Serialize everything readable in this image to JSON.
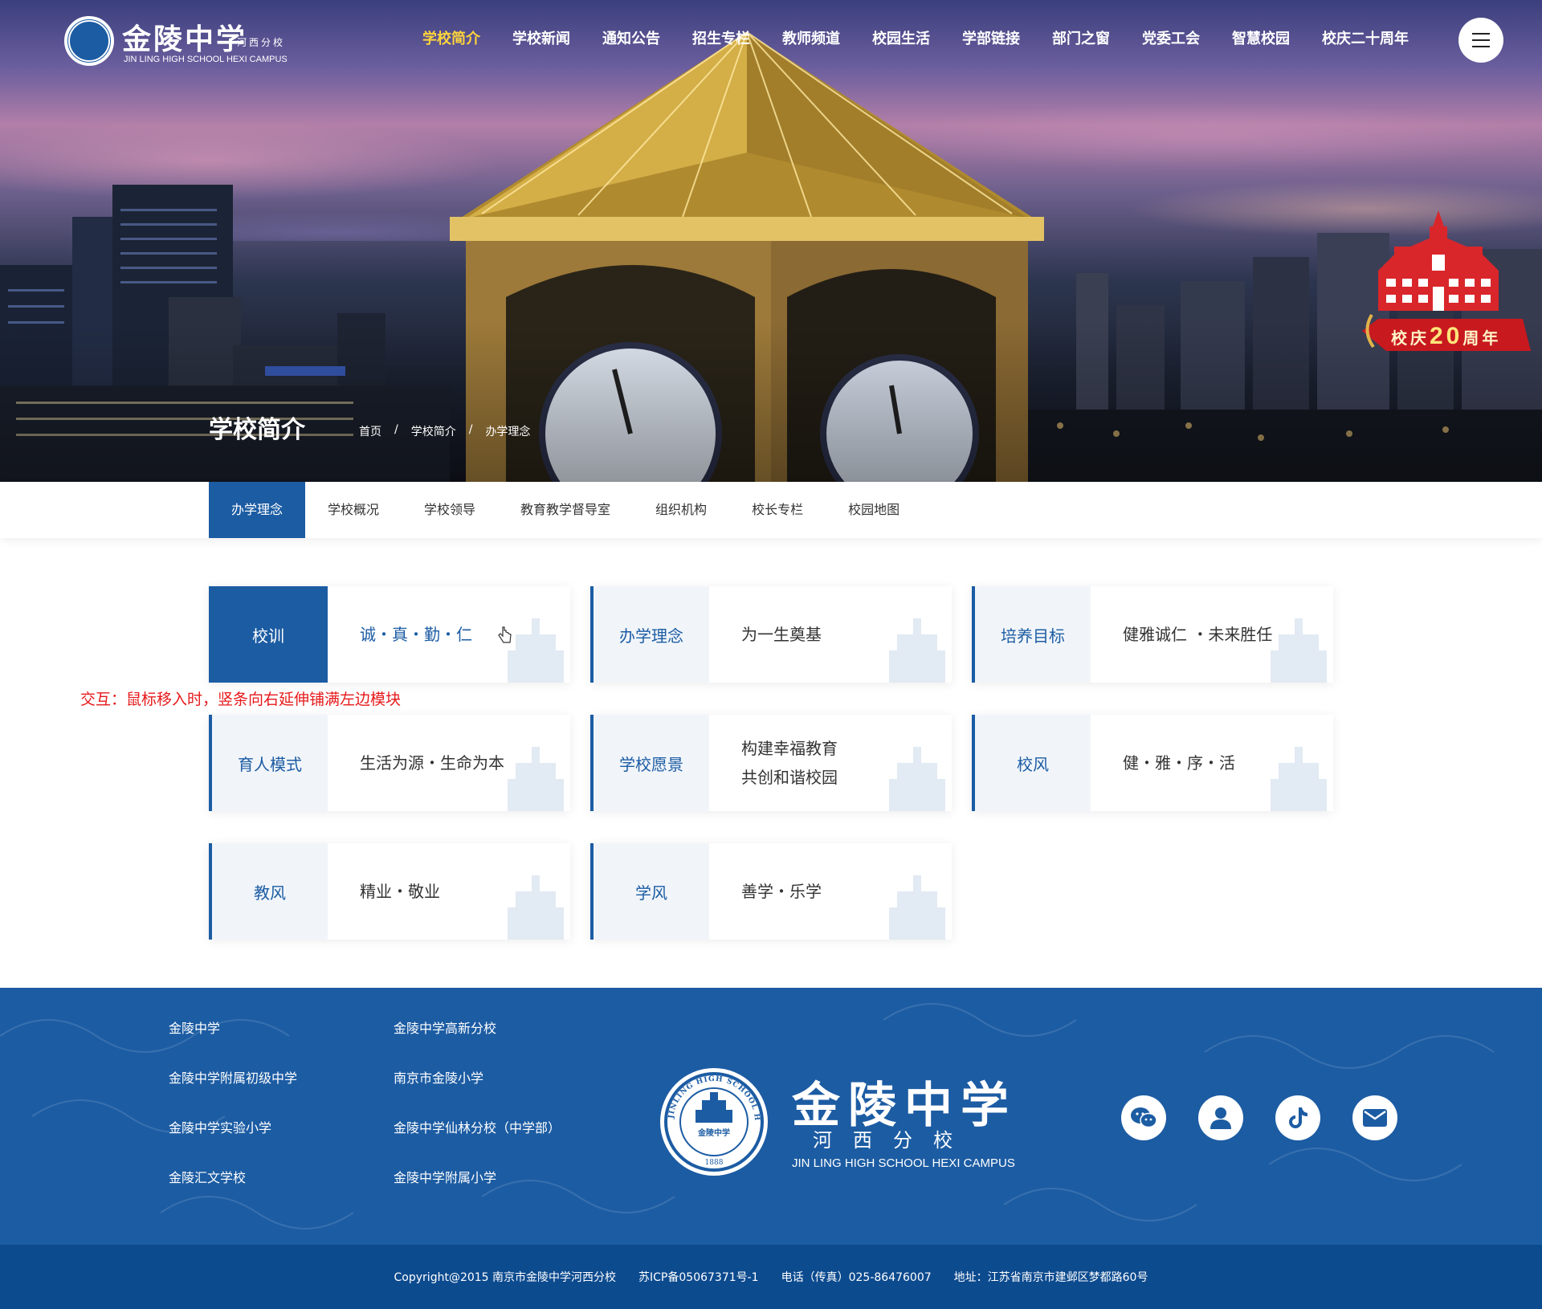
{
  "header": {
    "logo_cn": "金陵中学",
    "logo_sub": "河西分校",
    "logo_en": "JIN LING HIGH SCHOOL HEXI CAMPUS",
    "nav": [
      "学校简介",
      "学校新闻",
      "通知公告",
      "招生专栏",
      "教师频道",
      "校园生活",
      "学部链接",
      "部门之窗",
      "党委工会",
      "智慧校园",
      "校庆二十周年"
    ],
    "active_nav": "学校简介",
    "anniversary_badge": {
      "text_left": "校庆",
      "number": "20",
      "text_right": "周年"
    }
  },
  "banner": {
    "title": "学校简介",
    "breadcrumb": [
      "首页",
      "学校简介",
      "办学理念"
    ],
    "breadcrumb_sep": "/"
  },
  "subnav": {
    "items": [
      "办学理念",
      "学校概况",
      "学校领导",
      "教育教学督导室",
      "组织机构",
      "校长专栏",
      "校园地图"
    ],
    "active": "办学理念"
  },
  "cards": [
    {
      "label": "校训",
      "value": "诚・真・勤・仁",
      "hovered": true
    },
    {
      "label": "办学理念",
      "value": "为一生奠基",
      "hovered": false
    },
    {
      "label": "培养目标",
      "value": "健雅诚仁 ・未来胜任",
      "hovered": false
    },
    {
      "label": "育人模式",
      "value": "生活为源・生命为本",
      "hovered": false
    },
    {
      "label": "学校愿景",
      "value": "构建幸福教育\n共创和谐校园",
      "hovered": false
    },
    {
      "label": "校风",
      "value": "健・雅・序・活",
      "hovered": false
    },
    {
      "label": "教风",
      "value": "精业・敬业",
      "hovered": false
    },
    {
      "label": "学风",
      "value": "善学・乐学",
      "hovered": false
    }
  ],
  "annotation": "交互：鼠标移入时，竖条向右延伸铺满左边模块",
  "footer": {
    "links_col1": [
      "金陵中学",
      "金陵中学附属初级中学",
      "金陵中学实验小学",
      "金陵汇文学校"
    ],
    "links_col2": [
      "金陵中学高新分校",
      "南京市金陵小学",
      "金陵中学仙林分校（中学部）",
      "金陵中学附属小学"
    ],
    "logo_cn": "金陵中学",
    "logo_sub": "河西分校",
    "logo_en": "JIN LING HIGH SCHOOL HEXI CAMPUS",
    "seal_ring_text": "JINLING HIGH SCHOOL HEXI CAMPUS",
    "seal_center_text": "金陵中学",
    "seal_year": "1888",
    "social_icons": [
      "wechat-icon",
      "user-icon",
      "tiktok-icon",
      "mail-icon"
    ],
    "copyright": "Copyright@2015 南京市金陵中学河西分校",
    "icp": "苏ICP备05067371号-1",
    "phone": "电话（传真）025-86476007",
    "address": "地址：江苏省南京市建邺区梦都路60号"
  },
  "colors": {
    "primary": "#1c5ca3",
    "nav_active": "#ffd43b",
    "annotation": "#e6191b",
    "card_left_bg": "#f1f5fa"
  }
}
